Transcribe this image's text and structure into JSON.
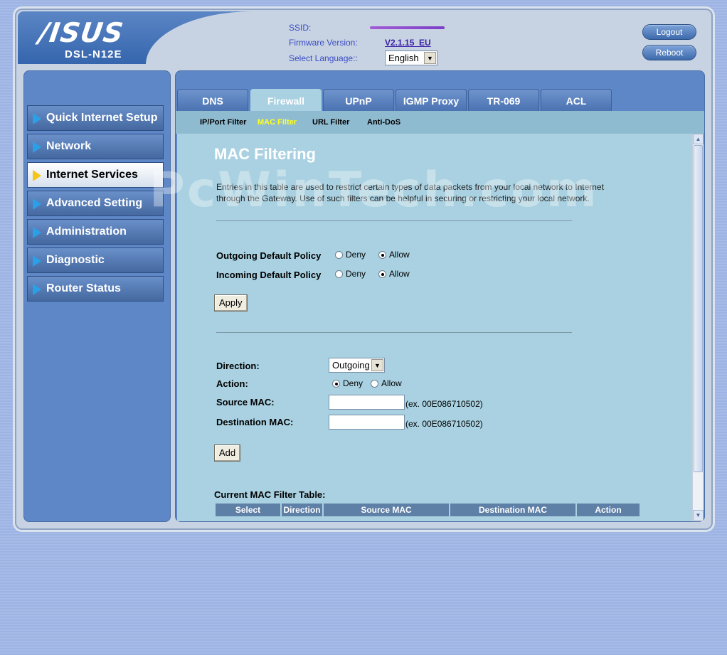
{
  "header": {
    "brand": "/ISUS",
    "model": "DSL-N12E",
    "ssid_label": "SSID:",
    "firmware_label": "Firmware Version:",
    "firmware_value": "V2.1.15_EU",
    "language_label": "Select Language::",
    "language_value": "English",
    "logout_label": "Logout",
    "reboot_label": "Reboot"
  },
  "sidebar": {
    "items": [
      {
        "label": "Quick Internet Setup"
      },
      {
        "label": "Network"
      },
      {
        "label": "Internet Services"
      },
      {
        "label": "Advanced Setting"
      },
      {
        "label": "Administration"
      },
      {
        "label": "Diagnostic"
      },
      {
        "label": "Router Status"
      }
    ],
    "active_index": 2
  },
  "tabs": [
    {
      "label": "DNS"
    },
    {
      "label": "Firewall"
    },
    {
      "label": "UPnP"
    },
    {
      "label": "IGMP Proxy"
    },
    {
      "label": "TR-069"
    },
    {
      "label": "ACL"
    }
  ],
  "subtabs": [
    {
      "label": "IP/Port Filter"
    },
    {
      "label": "MAC Filter"
    },
    {
      "label": "URL Filter"
    },
    {
      "label": "Anti-DoS"
    }
  ],
  "watermark": "PcWinTech.com",
  "main": {
    "title": "MAC Filtering",
    "description": "Entries in this table are used to restrict certain types of data packets from your local network to Internet through the Gateway. Use of such filters can be helpful in securing or restricting your local network.",
    "outgoing_label": "Outgoing Default Policy",
    "incoming_label": "Incoming Default Policy",
    "deny_label": "Deny",
    "allow_label": "Allow",
    "apply_label": "Apply",
    "direction_label": "Direction:",
    "direction_value": "Outgoing",
    "action_label": "Action:",
    "source_mac_label": "Source MAC:",
    "dest_mac_label": "Destination MAC:",
    "mac_hint": "(ex. 00E086710502)",
    "add_label": "Add",
    "table_title": "Current MAC Filter Table:",
    "table_headers": [
      "Select",
      "Direction",
      "Source MAC",
      "Destination MAC",
      "Action"
    ]
  }
}
